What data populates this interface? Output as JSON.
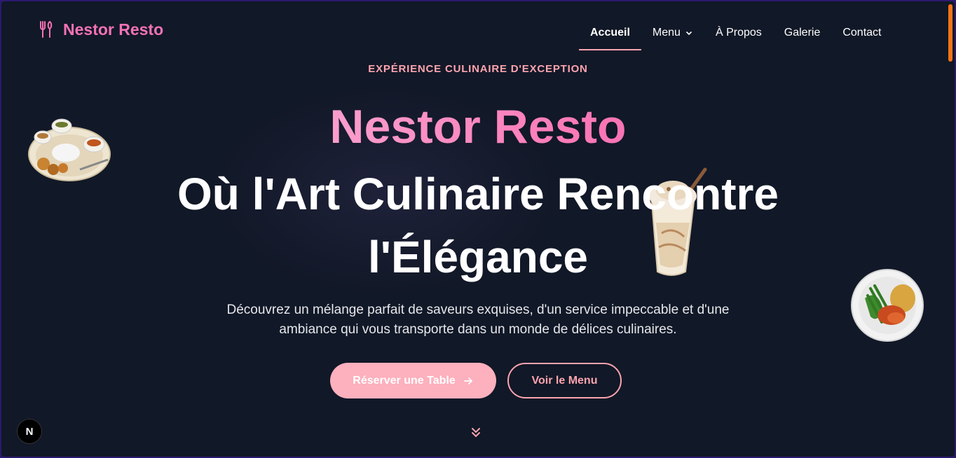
{
  "brand": {
    "name": "Nestor Resto",
    "icon": "utensils-icon"
  },
  "nav": {
    "items": [
      {
        "label": "Accueil",
        "active": true
      },
      {
        "label": "Menu",
        "dropdown": true
      },
      {
        "label": "À Propos"
      },
      {
        "label": "Galerie"
      },
      {
        "label": "Contact"
      }
    ]
  },
  "hero": {
    "eyebrow": "EXPÉRIENCE CULINAIRE D'EXCEPTION",
    "brand": "Nestor Resto",
    "title": "Où l'Art Culinaire Rencontre l'Élégance",
    "description": "Découvrez un mélange parfait de saveurs exquises, d'un service impeccable et d'une ambiance qui vous transporte dans un monde de délices culinaires.",
    "primary_button": "Réserver une Table",
    "secondary_button": "Voir le Menu"
  },
  "badge": {
    "label": "N"
  },
  "colors": {
    "background": "#111827",
    "accent": "#f472b6",
    "button": "#fdb0bd",
    "scrollbar": "#f97316"
  }
}
